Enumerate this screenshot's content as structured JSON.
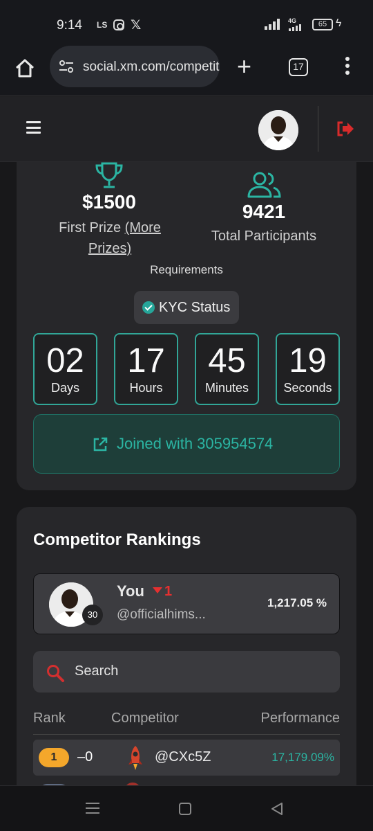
{
  "status_bar": {
    "time": "9:14",
    "ls_label": "LS",
    "x_label": "𝕏",
    "network": "4G",
    "battery": "65"
  },
  "browser": {
    "url": "social.xm.com/competitions",
    "tab_count": "17"
  },
  "competition": {
    "prize_value": "$1500",
    "prize_label": "First Prize",
    "more_prizes_label": "(More Prizes)",
    "participants_value": "9421",
    "participants_label": "Total Participants",
    "requirements_label": "Requirements",
    "kyc_label": "KYC Status",
    "countdown": [
      {
        "value": "02",
        "unit": "Days"
      },
      {
        "value": "17",
        "unit": "Hours"
      },
      {
        "value": "45",
        "unit": "Minutes"
      },
      {
        "value": "19",
        "unit": "Seconds"
      }
    ],
    "joined_label": "Joined with 305954574"
  },
  "rankings": {
    "title": "Competitor Rankings",
    "you": {
      "name": "You",
      "change": "1",
      "handle": "@officialhims...",
      "rank": "30",
      "performance": "1,217.05 %"
    },
    "search_placeholder": "Search",
    "columns": {
      "rank": "Rank",
      "competitor": "Competitor",
      "performance": "Performance"
    },
    "rows": [
      {
        "rank": "1",
        "change": "–0",
        "handle": "@CXc5Z",
        "performance": "17,179.09%"
      }
    ]
  },
  "colors": {
    "accent": "#2bb5a3",
    "accent_border": "#31a697",
    "rank_gold": "#f4a72b",
    "negative": "#e53030",
    "logout": "#d92b2b"
  }
}
